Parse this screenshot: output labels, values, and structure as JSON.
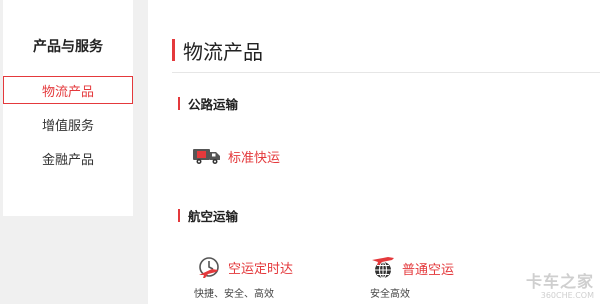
{
  "sidebar": {
    "title": "产品与服务",
    "items": [
      {
        "label": "物流产品",
        "active": true
      },
      {
        "label": "增值服务",
        "active": false
      },
      {
        "label": "金融产品",
        "active": false
      }
    ]
  },
  "main": {
    "title": "物流产品",
    "sections": [
      {
        "label": "公路运输",
        "products": [
          {
            "label": "标准快运",
            "icon": "truck-icon",
            "desc": ""
          }
        ]
      },
      {
        "label": "航空运输",
        "products": [
          {
            "label": "空运定时达",
            "icon": "clock-plane-icon",
            "desc": "快捷、安全、高效"
          },
          {
            "label": "普通空运",
            "icon": "globe-plane-icon",
            "desc": "安全高效"
          }
        ]
      }
    ]
  },
  "watermark": {
    "text": "卡车之家",
    "sub": "360CHE.COM"
  },
  "colors": {
    "accent": "#e4393c",
    "background": "#f0f0f0",
    "panel": "#ffffff"
  }
}
